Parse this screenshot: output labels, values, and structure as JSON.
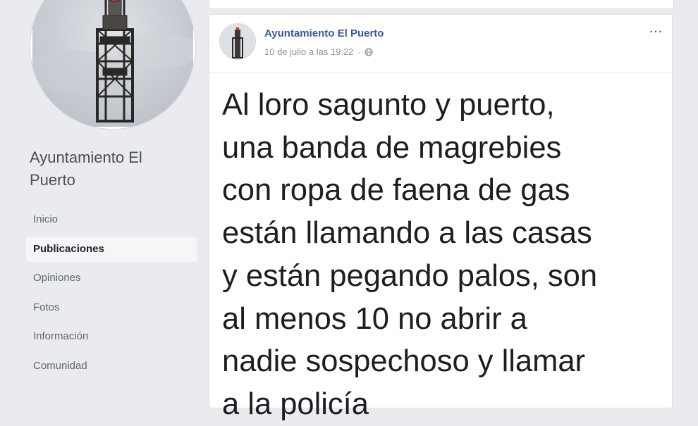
{
  "page": {
    "name": "Ayuntamiento El Puerto"
  },
  "nav": {
    "items": [
      "Inicio",
      "Publicaciones",
      "Opiniones",
      "Fotos",
      "Información",
      "Comunidad"
    ],
    "active": "Publicaciones"
  },
  "post": {
    "author": "Ayuntamiento El Puerto",
    "timestamp": "10 de julio a las 19:22",
    "audience_icon": "globe-icon",
    "more_label": "···",
    "text": "Al loro sagunto y puerto,\nuna banda de magrebies\ncon ropa de faena de gas\nestán llamando a las casas\ny están pegando palos, son\nal menos 10 no abrir a\nnadie sospechoso y llamar\na la policía"
  },
  "colors": {
    "background": "#e9ebee",
    "link": "#385898",
    "active_nav_bg": "#f5f6f7"
  }
}
